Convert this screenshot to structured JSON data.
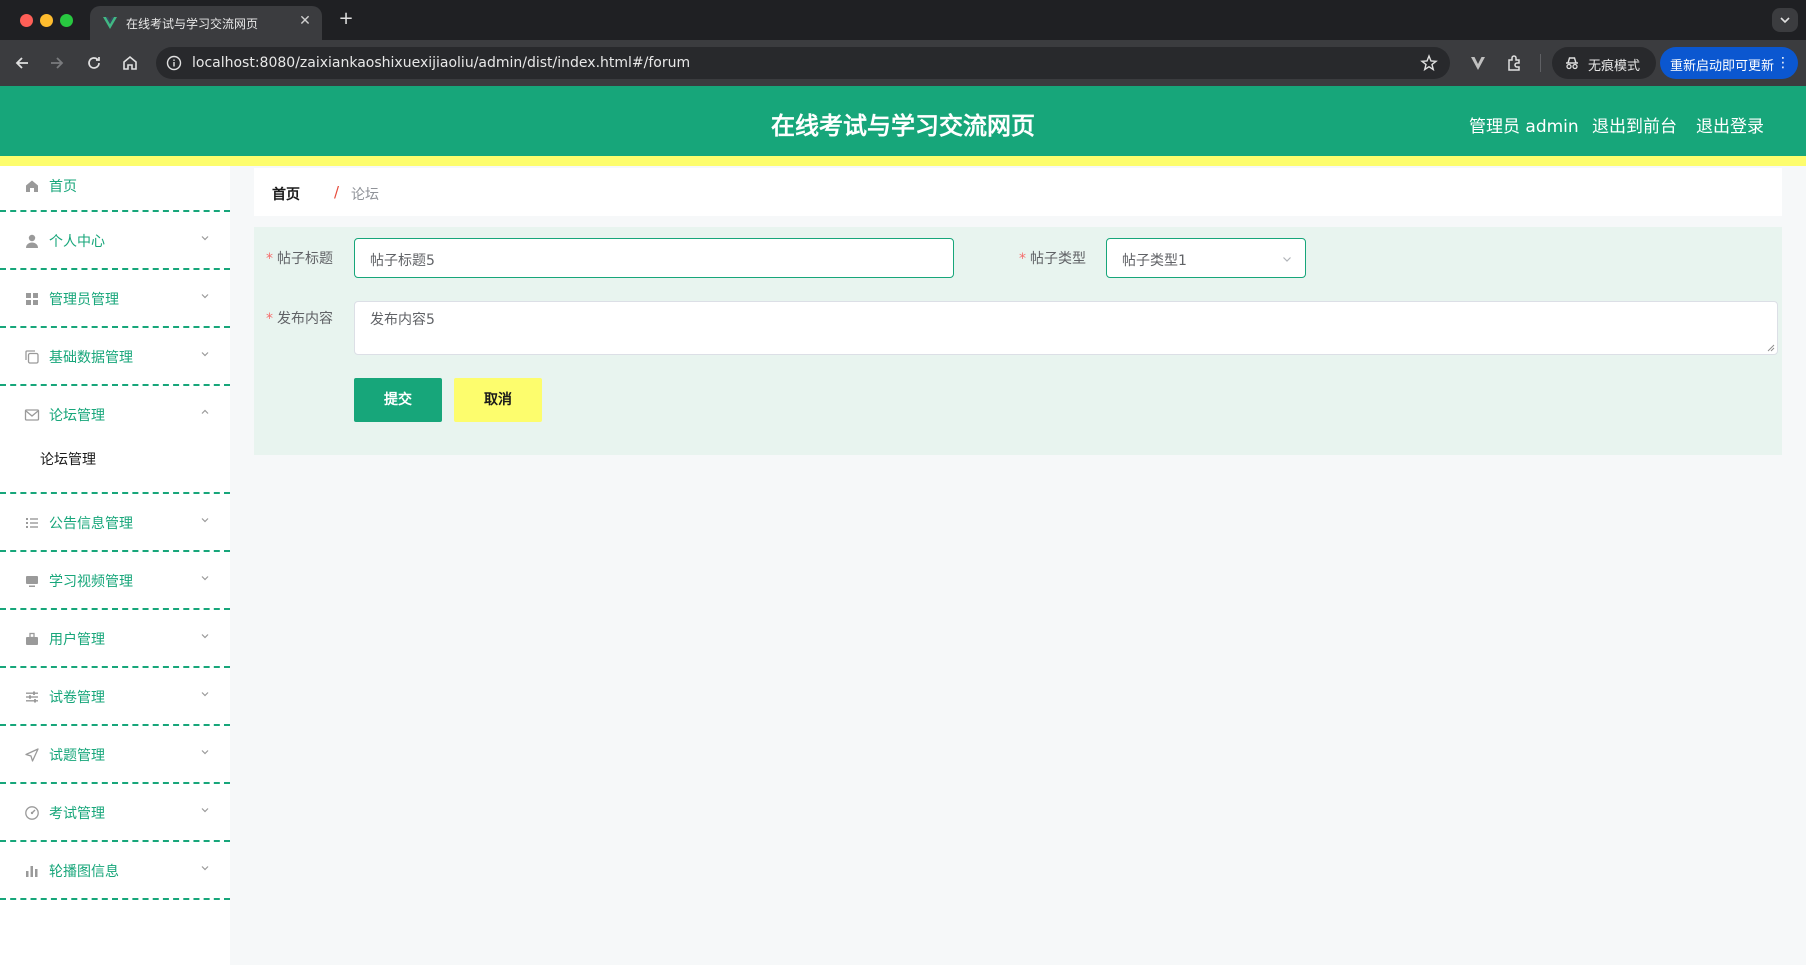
{
  "browser": {
    "tab_title": "在线考试与学习交流网页",
    "url": "localhost:8080/zaixiankaoshixuexijiaoliu/admin/dist/index.html#/forum",
    "incognito_label": "无痕模式",
    "update_label": "重新启动即可更新"
  },
  "header": {
    "title": "在线考试与学习交流网页",
    "user_label": "管理员 admin",
    "front_link": "退出到前台",
    "logout_link": "退出登录"
  },
  "colors": {
    "primary": "#17a67a",
    "accent_yellow": "#fdfd6d",
    "required": "#f56c6c"
  },
  "sidebar": {
    "items": [
      {
        "label": "首页",
        "icon": "home-icon"
      },
      {
        "label": "个人中心",
        "icon": "user-icon"
      },
      {
        "label": "管理员管理",
        "icon": "grid-icon"
      },
      {
        "label": "基础数据管理",
        "icon": "copy-icon"
      },
      {
        "label": "论坛管理",
        "icon": "mail-icon",
        "expanded": true,
        "children": [
          "论坛管理"
        ]
      },
      {
        "label": "公告信息管理",
        "icon": "list-icon"
      },
      {
        "label": "学习视频管理",
        "icon": "monitor-icon"
      },
      {
        "label": "用户管理",
        "icon": "suitcase-icon"
      },
      {
        "label": "试卷管理",
        "icon": "sliders-icon"
      },
      {
        "label": "试题管理",
        "icon": "send-icon"
      },
      {
        "label": "考试管理",
        "icon": "gauge-icon"
      },
      {
        "label": "轮播图信息",
        "icon": "bar-chart-icon"
      }
    ]
  },
  "breadcrumb": {
    "home": "首页",
    "separator": "/",
    "current": "论坛"
  },
  "form": {
    "title_label": "帖子标题",
    "title_value": "帖子标题5",
    "type_label": "帖子类型",
    "type_value": "帖子类型1",
    "content_label": "发布内容",
    "content_value": "发布内容5",
    "required_mark": "*",
    "submit_label": "提交",
    "cancel_label": "取消"
  }
}
